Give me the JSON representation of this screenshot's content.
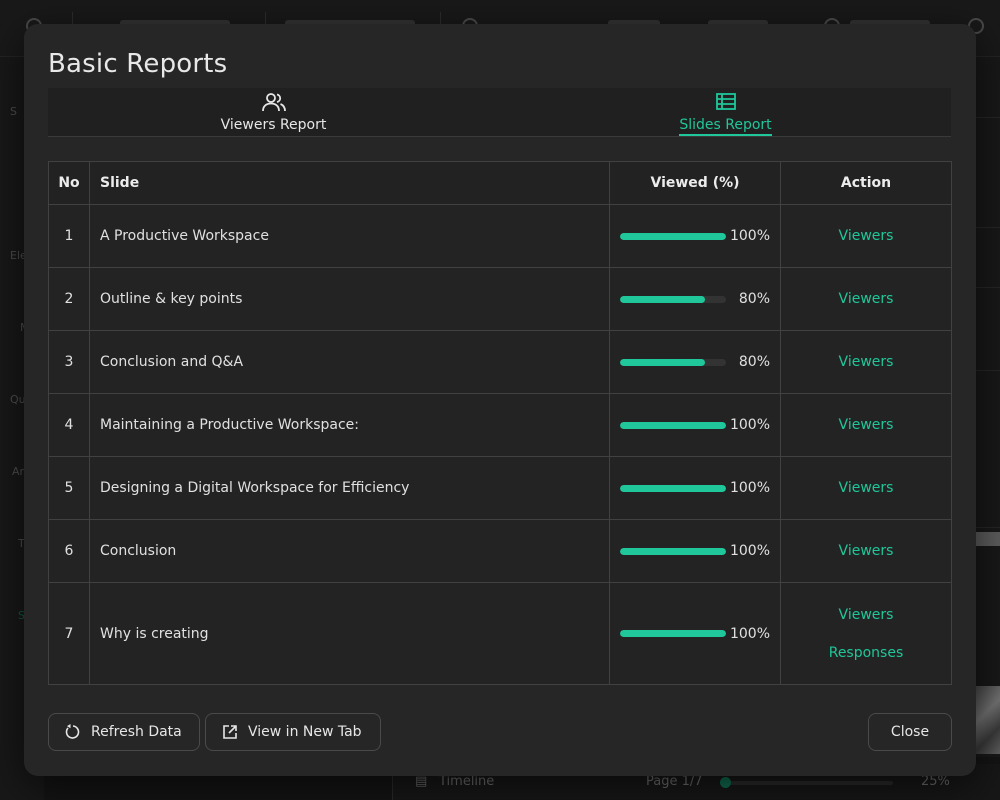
{
  "background": {
    "left_labels": [
      "S",
      "Ele",
      "M",
      "Qu",
      "An",
      "T",
      "S"
    ],
    "bottom_bar": {
      "timeline_label": "Timeline",
      "page_label": "Page 1/7",
      "zoom_label": "25%"
    }
  },
  "modal": {
    "title": "Basic Reports",
    "tabs": [
      {
        "label": "Viewers Report",
        "icon": "users-icon",
        "active": false
      },
      {
        "label": "Slides Report",
        "icon": "table-icon",
        "active": true
      }
    ],
    "table": {
      "headers": {
        "no": "No",
        "slide": "Slide",
        "viewed": "Viewed (%)",
        "action": "Action"
      },
      "rows": [
        {
          "no": "1",
          "slide": "A Productive Workspace",
          "viewed_pct": 100,
          "viewed_label": "100%",
          "actions": [
            "Viewers"
          ]
        },
        {
          "no": "2",
          "slide": "Outline & key points",
          "viewed_pct": 80,
          "viewed_label": "80%",
          "actions": [
            "Viewers"
          ]
        },
        {
          "no": "3",
          "slide": "Conclusion and Q&A",
          "viewed_pct": 80,
          "viewed_label": "80%",
          "actions": [
            "Viewers"
          ]
        },
        {
          "no": "4",
          "slide": "Maintaining a Productive Workspace:",
          "viewed_pct": 100,
          "viewed_label": "100%",
          "actions": [
            "Viewers"
          ]
        },
        {
          "no": "5",
          "slide": "Designing a Digital Workspace for Efficiency",
          "viewed_pct": 100,
          "viewed_label": "100%",
          "actions": [
            "Viewers"
          ]
        },
        {
          "no": "6",
          "slide": "Conclusion",
          "viewed_pct": 100,
          "viewed_label": "100%",
          "actions": [
            "Viewers"
          ]
        },
        {
          "no": "7",
          "slide": "Why is creating",
          "viewed_pct": 100,
          "viewed_label": "100%",
          "actions": [
            "Viewers",
            "Responses"
          ]
        }
      ]
    },
    "buttons": {
      "refresh": {
        "label": "Refresh Data",
        "icon": "refresh-icon"
      },
      "new_tab": {
        "label": "View in New Tab",
        "icon": "external-link-icon"
      },
      "close": {
        "label": "Close"
      }
    }
  },
  "colors": {
    "accent": "#1fc79a",
    "modal_bg": "#262626",
    "border": "#414141",
    "backdrop": "#141414"
  }
}
